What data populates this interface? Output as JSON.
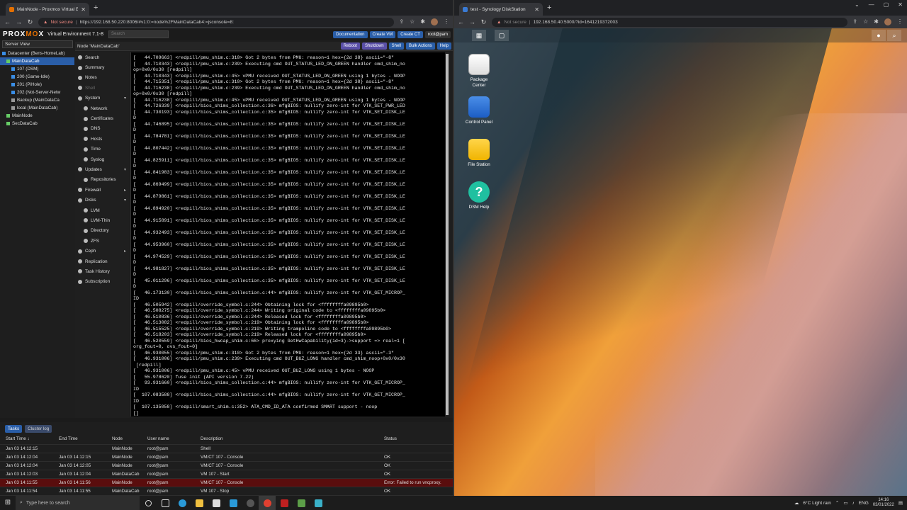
{
  "left_browser": {
    "tab_title": "MainNode - Proxmox Virtual Env",
    "security": "Not secure",
    "url": "https://192.168.50.220:8006/#v1:0:=node%2FMainDataCab4:=jsconsole=8:"
  },
  "right_browser": {
    "tab_title": "test - Synology DiskStation",
    "security": "Not secure",
    "url": "192.168.50.40:5000/?id=1641219372003"
  },
  "proxmox": {
    "brand_a": "PROX",
    "brand_b": "MO",
    "brand_c": "X",
    "version": "Virtual Environment 7.1-8",
    "search_placeholder": "Search",
    "header_buttons": {
      "docs": "Documentation",
      "create_vm": "Create VM",
      "create_ct": "Create CT",
      "user": "root@pam"
    },
    "server_view": "Server View",
    "tree": [
      "Datacenter (Bens-HomeLab)",
      "MainDataCab",
      "107 (DSM)",
      "200 (Game-Idle)",
      "201 (PiHole)",
      "202 (Not-Server-Netw",
      "Backup (MainDataCa",
      "local (MainDataCab)",
      "MainNode",
      "SecDataCab"
    ],
    "node_title": "Node 'MainDataCab'",
    "node_buttons": {
      "reboot": "Reboot",
      "shutdown": "Shutdown",
      "shell": "Shell",
      "bulk": "Bulk Actions",
      "help": "Help"
    },
    "menu": [
      "Search",
      "Summary",
      "Notes",
      "Shell",
      "System",
      "Network",
      "Certificates",
      "DNS",
      "Hosts",
      "Time",
      "Syslog",
      "Updates",
      "Repositories",
      "Firewall",
      "Disks",
      "LVM",
      "LVM-Thin",
      "Directory",
      "ZFS",
      "Ceph",
      "Replication",
      "Task History",
      "Subscription"
    ],
    "console": [
      "[   44.709663] <redpill/pmu_shim.c:310> Got 2 bytes from PMU: reason=1 hex={2d 38} ascii=\"-8\"",
      "[   44.710343] <redpill/pmu_shim.c:239> Executing cmd OUT_STATUS_LED_ON_GREEN handler cmd_shim_no",
      "op+0x0/0x30 [redpill]",
      "[   44.710343] <redpill/pmu_shim.c:45> vPMU received OUT_STATUS_LED_ON_GREEN using 1 bytes - NOOP",
      "[   44.715351] <redpill/pmu_shim.c:310> Got 2 bytes from PMU: reason=1 hex={2d 38} ascii=\"-8\"",
      "[   44.716238] <redpill/pmu_shim.c:239> Executing cmd OUT_STATUS_LED_ON_GREEN handler cmd_shim_no",
      "op+0x0/0x30 [redpill]",
      "[   44.716238] <redpill/pmu_shim.c:45> vPMU received OUT_STATUS_LED_ON_GREEN using 1 bytes - NOOP",
      "[   44.726339] <redpill/bios_shims_collection.c:36> mfgBIOS: nullify zero-int for VTK_SET_PWR_LED",
      "[   44.730193] <redpill/bios_shims_collection.c:35> mfgBIOS: nullify zero-int for VTK_SET_DISK_LE",
      "D",
      "[   44.746895] <redpill/bios_shims_collection.c:35> mfgBIOS: nullify zero-int for VTK_SET_DISK_LE",
      "D",
      "[   44.784781] <redpill/bios_shims_collection.c:35> mfgBIOS: nullify zero-int for VTK_SET_DISK_LE",
      "D",
      "[   44.807442] <redpill/bios_shims_collection.c:35> mfgBIOS: nullify zero-int for VTK_SET_DISK_LE",
      "D",
      "[   44.825911] <redpill/bios_shims_collection.c:35> mfgBIOS: nullify zero-int for VTK_SET_DISK_LE",
      "D",
      "[   44.841983] <redpill/bios_shims_collection.c:35> mfgBIOS: nullify zero-int for VTK_SET_DISK_LE",
      "D",
      "[   44.869499] <redpill/bios_shims_collection.c:35> mfgBIOS: nullify zero-int for VTK_SET_DISK_LE",
      "D",
      "[   44.879861] <redpill/bios_shims_collection.c:35> mfgBIOS: nullify zero-int for VTK_SET_DISK_LE",
      "D",
      "[   44.894920] <redpill/bios_shims_collection.c:35> mfgBIOS: nullify zero-int for VTK_SET_DISK_LE",
      "D",
      "[   44.915891] <redpill/bios_shims_collection.c:35> mfgBIOS: nullify zero-int for VTK_SET_DISK_LE",
      "D",
      "[   44.932493] <redpill/bios_shims_collection.c:35> mfgBIOS: nullify zero-int for VTK_SET_DISK_LE",
      "D",
      "[   44.953960] <redpill/bios_shims_collection.c:35> mfgBIOS: nullify zero-int for VTK_SET_DISK_LE",
      "D",
      "[   44.974529] <redpill/bios_shims_collection.c:35> mfgBIOS: nullify zero-int for VTK_SET_DISK_LE",
      "D",
      "[   44.981827] <redpill/bios_shims_collection.c:35> mfgBIOS: nullify zero-int for VTK_SET_DISK_LE",
      "D",
      "[   45.011296] <redpill/bios_shims_collection.c:35> mfgBIOS: nullify zero-int for VTK_SET_DISK_LE",
      "D",
      "[   46.173130] <redpill/bios_shims_collection.c:44> mfgBIOS: nullify zero-int for VTK_GET_MICROP_",
      "ID",
      "[   46.505942] <redpill/override_symbol.c:244> Obtaining lock for <ffffffffa09895b0>",
      "[   46.508275] <redpill/override_symbol.c:244> Writing original code to <ffffffffa09895b0>",
      "[   46.510836] <redpill/override_symbol.c:244> Released lock for <ffffffffa09895b0>",
      "[   46.513082] <redpill/override_symbol.c:219> Obtaining lock for <ffffffffa09895b0>",
      "[   46.515525] <redpill/override_symbol.c:219> Writing trampoline code to <ffffffffa09895b0>",
      "[   46.518203] <redpill/override_symbol.c:219> Released lock for <ffffffffa09895b0>",
      "[   46.520559] <redpill/bios_hwcap_shim.c:66> proxying GetHwCapability(id=3)->support => real=1 [",
      "org_fout=0, ovs_fout=0]",
      "[   46.930055] <redpill/pmu_shim.c:310> Got 2 bytes from PMU: reason=1 hex={2d 33} ascii=\"-3\"",
      "[   46.931006] <redpill/pmu_shim.c:239> Executing cmd OUT_BUZ_LONG handler cmd_shim_noop+0x0/0x30",
      " [redpill]",
      "[   46.931006] <redpill/pmu_shim.c:45> vPMU received OUT_BUZ_LONG using 1 bytes - NOOP",
      "[   55.978620] fuse init (API version 7.22)",
      "[   93.931660] <redpill/bios_shims_collection.c:44> mfgBIOS: nullify zero-int for VTK_GET_MICROP_",
      "ID",
      "[  107.083588] <redpill/bios_shims_collection.c:44> mfgBIOS: nullify zero-int for VTK_GET_MICROP_",
      "ID",
      "[  107.135058] <redpill/smart_shim.c:352> ATA_CMD_ID_ATA confirmed SMART support - noop",
      "[]"
    ],
    "log_tabs": [
      "Tasks",
      "Cluster log"
    ],
    "log_columns": [
      "Start Time ↓",
      "End Time",
      "Node",
      "User name",
      "Description",
      "Status"
    ],
    "log_rows": [
      [
        "Jan 03 14:12:15",
        "",
        "MainNode",
        "root@pam",
        "Shell",
        ""
      ],
      [
        "Jan 03 14:12:04",
        "Jan 03 14:12:15",
        "MainNode",
        "root@pam",
        "VM/CT 107 - Console",
        "OK"
      ],
      [
        "Jan 03 14:12:04",
        "Jan 03 14:12:05",
        "MainNode",
        "root@pam",
        "VM/CT 107 - Console",
        "OK"
      ],
      [
        "Jan 03 14:12:03",
        "Jan 03 14:12:04",
        "MainDataCab",
        "root@pam",
        "VM 107 - Start",
        "OK"
      ],
      [
        "Jan 03 14:11:55",
        "Jan 03 14:11:56",
        "MainNode",
        "root@pam",
        "VM/CT 107 - Console",
        "Error: Failed to run vncproxy."
      ],
      [
        "Jan 03 14:11:54",
        "Jan 03 14:11:55",
        "MainDataCab",
        "root@pam",
        "VM 107 - Stop",
        "OK"
      ]
    ]
  },
  "dsm": {
    "icons": [
      "Package Center",
      "Control Panel",
      "File Station",
      "DSM Help"
    ]
  },
  "taskbar": {
    "search": "Type here to search",
    "weather": "6°C  Light rain",
    "lang": "ENG",
    "time": "14:16",
    "date": "03/01/2022"
  }
}
